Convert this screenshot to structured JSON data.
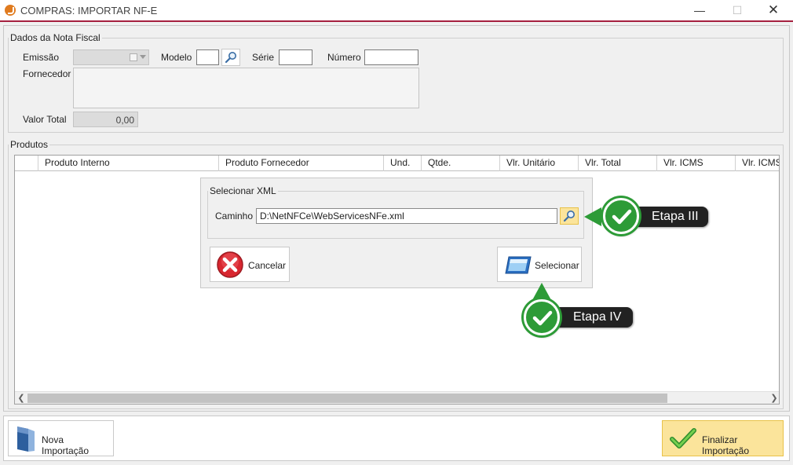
{
  "window": {
    "title": "COMPRAS: IMPORTAR NF-E",
    "minimize": "—",
    "maximize": "☐",
    "close": "✕"
  },
  "nota_fiscal": {
    "legend": "Dados da Nota Fiscal",
    "emissao_label": "Emissão",
    "emissao_value": "",
    "modelo_label": "Modelo",
    "modelo_value": "",
    "serie_label": "Série",
    "serie_value": "",
    "numero_label": "Número",
    "numero_value": "",
    "fornecedor_label": "Fornecedor",
    "fornecedor_value": "",
    "valor_total_label": "Valor Total",
    "valor_total_value": "0,00"
  },
  "produtos": {
    "legend": "Produtos",
    "columns": [
      "",
      "Produto Interno",
      "Produto Fornecedor",
      "Und.",
      "Qtde.",
      "Vlr. Unitário",
      "Vlr. Total",
      "Vlr. ICMS",
      "Vlr. ICMS-"
    ]
  },
  "dialog": {
    "legend": "Selecionar XML",
    "caminho_label": "Caminho",
    "caminho_value": "D:\\NetNFCe\\WebServicesNFe.xml",
    "cancel_label": "Cancelar",
    "select_label": "Selecionar"
  },
  "footer": {
    "nova_label": "Nova Importação",
    "finalizar_label": "Finalizar Importação"
  },
  "callouts": {
    "etapa3": "Etapa III",
    "etapa4": "Etapa IV"
  },
  "colors": {
    "title_accent": "#a5203f",
    "badge_green": "#2d9b37",
    "finalizar_bg": "#fbe49b"
  },
  "icons": {
    "app": "app-logo-icon",
    "search": "magnifier-icon",
    "calendar": "calendar-icon",
    "cancel": "red-x-icon",
    "select": "window-icon",
    "nova": "document-icon",
    "finalizar": "checkmark-icon"
  }
}
